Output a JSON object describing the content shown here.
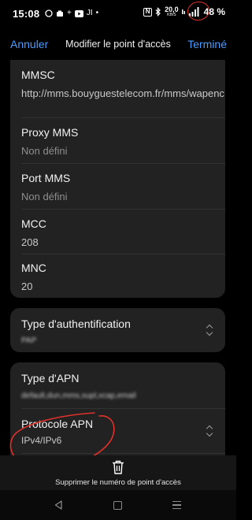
{
  "status_bar": {
    "time": "15:08",
    "left_icons": [
      "whatsapp-icon",
      "camera-icon",
      "plus-icon",
      "youtube-icon",
      "hash-icon",
      "dot-icon"
    ],
    "nfc_icon": "N",
    "bluetooth_icon": "bluetooth-icon",
    "speed_value": "20,0",
    "speed_unit": "KB/S",
    "battery": "48 %"
  },
  "header": {
    "cancel": "Annuler",
    "title": "Modifier le point d'accès",
    "done": "Terminé"
  },
  "fields": {
    "mmsc": {
      "label": "MMSC",
      "value": "http://mms.bouyguestelecom.fr/mms/wapenc"
    },
    "proxy_mms": {
      "label": "Proxy MMS",
      "value": "Non défini"
    },
    "port_mms": {
      "label": "Port MMS",
      "value": "Non défini"
    },
    "mcc": {
      "label": "MCC",
      "value": "208"
    },
    "mnc": {
      "label": "MNC",
      "value": "20"
    },
    "auth_type": {
      "label": "Type d'authentification",
      "value": "PAP"
    },
    "apn_type": {
      "label": "Type d'APN",
      "value": "default,dun,mms,supl,xcap,email"
    },
    "apn_protocol": {
      "label": "Protocole APN",
      "value": "IPv4/IPv6"
    }
  },
  "bottom_action": {
    "label": "Supprimer le numéro de point d'accès"
  },
  "colors": {
    "accent": "#4b9cff",
    "card": "#222222",
    "annotation": "#e0312a"
  }
}
